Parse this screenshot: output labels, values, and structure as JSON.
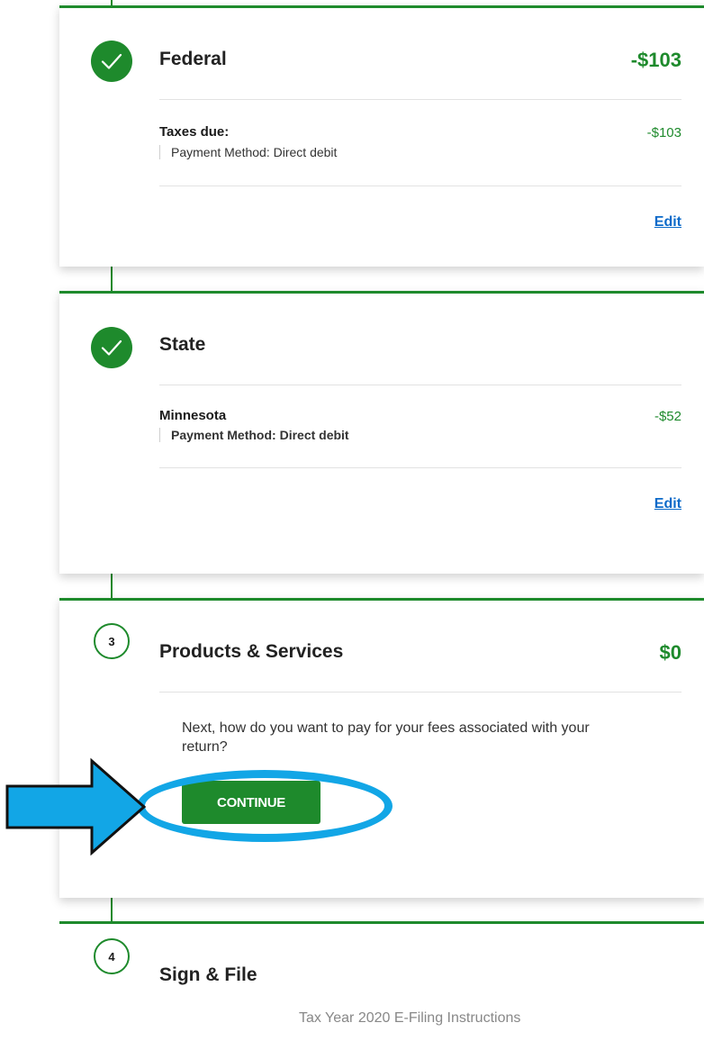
{
  "steps": [
    {
      "title": "Federal",
      "amount": "-$103",
      "row_label": "Taxes due:",
      "payment_label": "Payment Method:",
      "payment_value": "Direct debit",
      "row_amount": "-$103",
      "edit": "Edit"
    },
    {
      "title": "State",
      "amount": "",
      "row_label": "Minnesota",
      "payment_label": "Payment Method:",
      "payment_value": "Direct debit",
      "row_amount": "-$52",
      "edit": "Edit"
    },
    {
      "number": "3",
      "title": "Products & Services",
      "amount": "$0",
      "question": "Next, how do you want to pay for your fees associated with your return?",
      "continue": "CONTINUE"
    },
    {
      "number": "4",
      "title": "Sign & File"
    }
  ],
  "footer": "Tax Year 2020 E-Filing Instructions",
  "colors": {
    "accent": "#1e8a2c",
    "link": "#0b6ac9",
    "annotation": "#12a6e6"
  },
  "icons": [
    "checkmark-icon",
    "arrow-annotation",
    "highlight-ellipse"
  ]
}
